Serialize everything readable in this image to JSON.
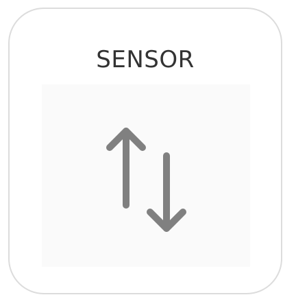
{
  "widget": {
    "title": "SENSOR",
    "icon": "up-down-arrows-icon",
    "icon_color": "#808080",
    "border_color": "#dcdcdc",
    "tile_background": "#fafafa"
  }
}
